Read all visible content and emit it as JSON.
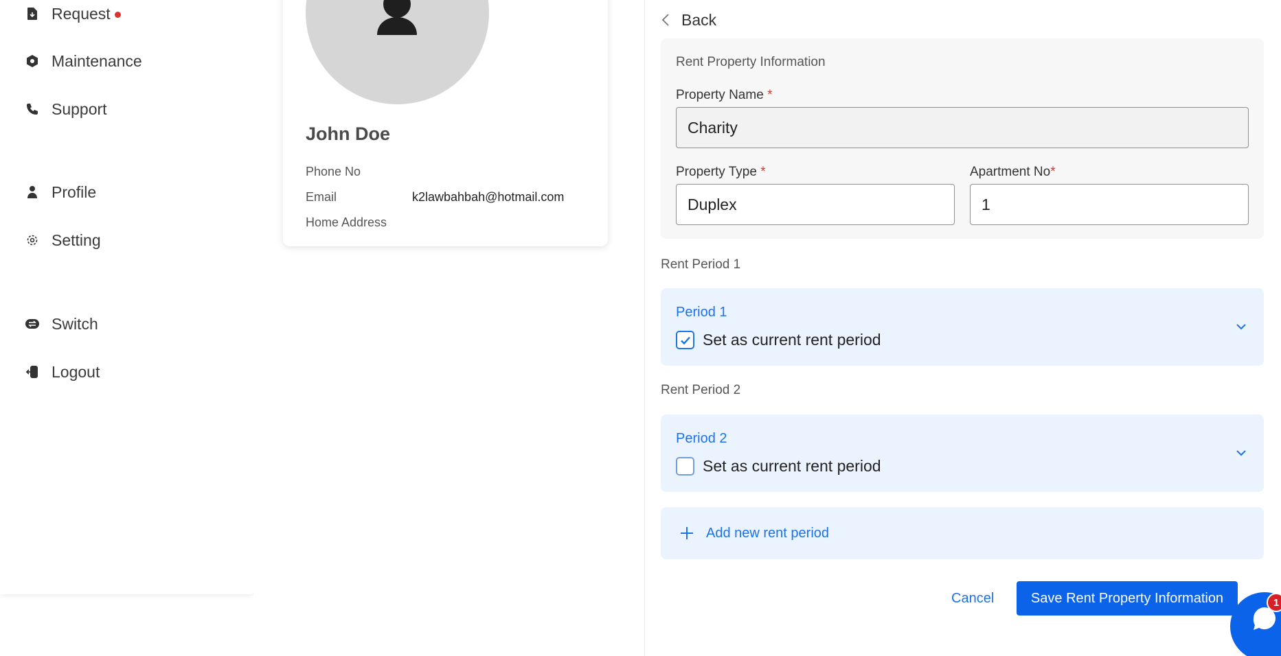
{
  "sidebar": {
    "items": [
      {
        "label": "Request",
        "icon": "request-icon"
      },
      {
        "label": "Maintenance",
        "icon": "maintenance-icon"
      },
      {
        "label": "Support",
        "icon": "phone-icon"
      },
      {
        "label": "Profile",
        "icon": "person-icon"
      },
      {
        "label": "Setting",
        "icon": "gear-icon"
      },
      {
        "label": "Switch",
        "icon": "switch-icon"
      },
      {
        "label": "Logout",
        "icon": "logout-icon"
      }
    ]
  },
  "profile": {
    "name": "John Doe",
    "phone_label": "Phone No",
    "phone_value": "",
    "email_label": "Email",
    "email_value": "k2lawbahbah@hotmail.com",
    "address_label": "Home Address",
    "address_value": ""
  },
  "form": {
    "back_label": "Back",
    "section_title": "Rent Property Information",
    "property_name_label": "Property Name",
    "property_name_value": "Charity",
    "property_type_label": "Property Type",
    "property_type_value": "Duplex",
    "apartment_no_label": "Apartment No",
    "apartment_no_value": "1",
    "required_mark": "*",
    "periods": [
      {
        "heading": "Rent Period 1",
        "title": "Period 1",
        "checkbox_label": "Set as current rent period",
        "checked": true
      },
      {
        "heading": "Rent Period 2",
        "title": "Period 2",
        "checkbox_label": "Set as current rent period",
        "checked": false
      }
    ],
    "add_period_label": "Add new rent period",
    "cancel_label": "Cancel",
    "save_label": "Save Rent Property Information"
  },
  "chat": {
    "badge_count": "1"
  },
  "colors": {
    "accent": "#0b63ea",
    "link": "#1a73e8",
    "danger": "#e0312b",
    "period_bg": "#ebf3fe"
  }
}
